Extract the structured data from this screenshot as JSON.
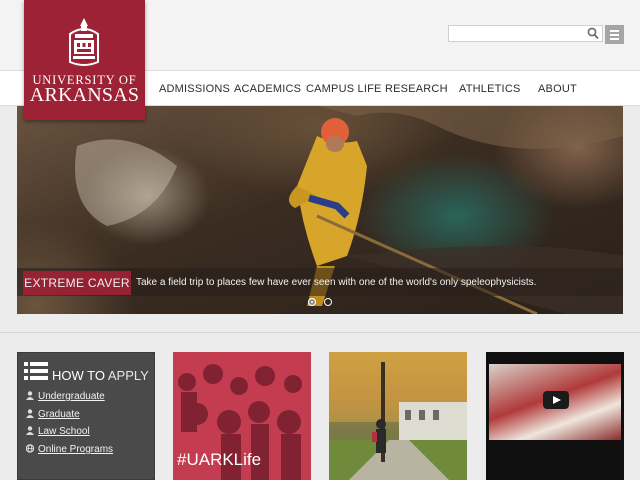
{
  "brand": {
    "line1": "UNIVERSITY OF",
    "line2": "ARKANSAS",
    "color": "#9d2235"
  },
  "header": {
    "search_placeholder": "",
    "search_icon": "search-icon",
    "menu_icon": "hamburger-menu-icon"
  },
  "nav": {
    "items": [
      {
        "label": "ADMISSIONS"
      },
      {
        "label": "ACADEMICS"
      },
      {
        "label": "CAMPUS LIFE"
      },
      {
        "label": "RESEARCH"
      },
      {
        "label": "ATHLETICS"
      },
      {
        "label": "ABOUT"
      }
    ]
  },
  "hero": {
    "tag": "EXTREME CAVER",
    "text": "Take a field trip to places few have ever seen with one of the world's only speleophysicists.",
    "slide_count": 2,
    "active_slide": 1
  },
  "apply": {
    "title_bold": "HOW TO",
    "title_thin": "APPLY",
    "links": [
      {
        "label": "Undergraduate",
        "icon": "user-icon"
      },
      {
        "label": "Graduate",
        "icon": "user-icon"
      },
      {
        "label": "Law School",
        "icon": "user-icon"
      },
      {
        "label": "Online Programs",
        "icon": "globe-icon"
      }
    ]
  },
  "tiles": {
    "social_hashtag": "#UARKLife",
    "video_icon": "play-icon"
  }
}
